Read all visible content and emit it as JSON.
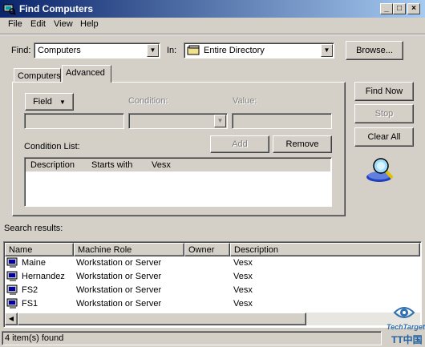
{
  "window": {
    "title": "Find Computers"
  },
  "menu": [
    "File",
    "Edit",
    "View",
    "Help"
  ],
  "find_row": {
    "find_label": "Find:",
    "find_value": "Computers",
    "in_label": "In:",
    "in_value": "Entire Directory",
    "browse_label": "Browse..."
  },
  "tabs": [
    {
      "label": "Computers",
      "active": false
    },
    {
      "label": "Advanced",
      "active": true
    }
  ],
  "advanced": {
    "field_button": "Field",
    "condition_label": "Condition:",
    "value_label": "Value:",
    "add_label": "Add",
    "remove_label": "Remove",
    "condition_list_label": "Condition List:",
    "condition_item": {
      "description": "Description",
      "condition": "Starts with",
      "value": "Vesx"
    }
  },
  "actions": {
    "find_now": "Find Now",
    "stop": "Stop",
    "clear_all": "Clear All"
  },
  "results": {
    "label": "Search results:",
    "columns": [
      "Name",
      "Machine Role",
      "Owner",
      "Description"
    ],
    "rows": [
      {
        "name": "Maine",
        "role": "Workstation or Server",
        "owner": "",
        "description": "Vesx"
      },
      {
        "name": "Hernandez",
        "role": "Workstation or Server",
        "owner": "",
        "description": "Vesx"
      },
      {
        "name": "FS2",
        "role": "Workstation or Server",
        "owner": "",
        "description": "Vesx"
      },
      {
        "name": "FS1",
        "role": "Workstation or Server",
        "owner": "",
        "description": "Vesx"
      }
    ]
  },
  "status": {
    "text": "4 item(s) found"
  },
  "watermark": {
    "brand": "TechTarget",
    "sub": "TT中国"
  }
}
